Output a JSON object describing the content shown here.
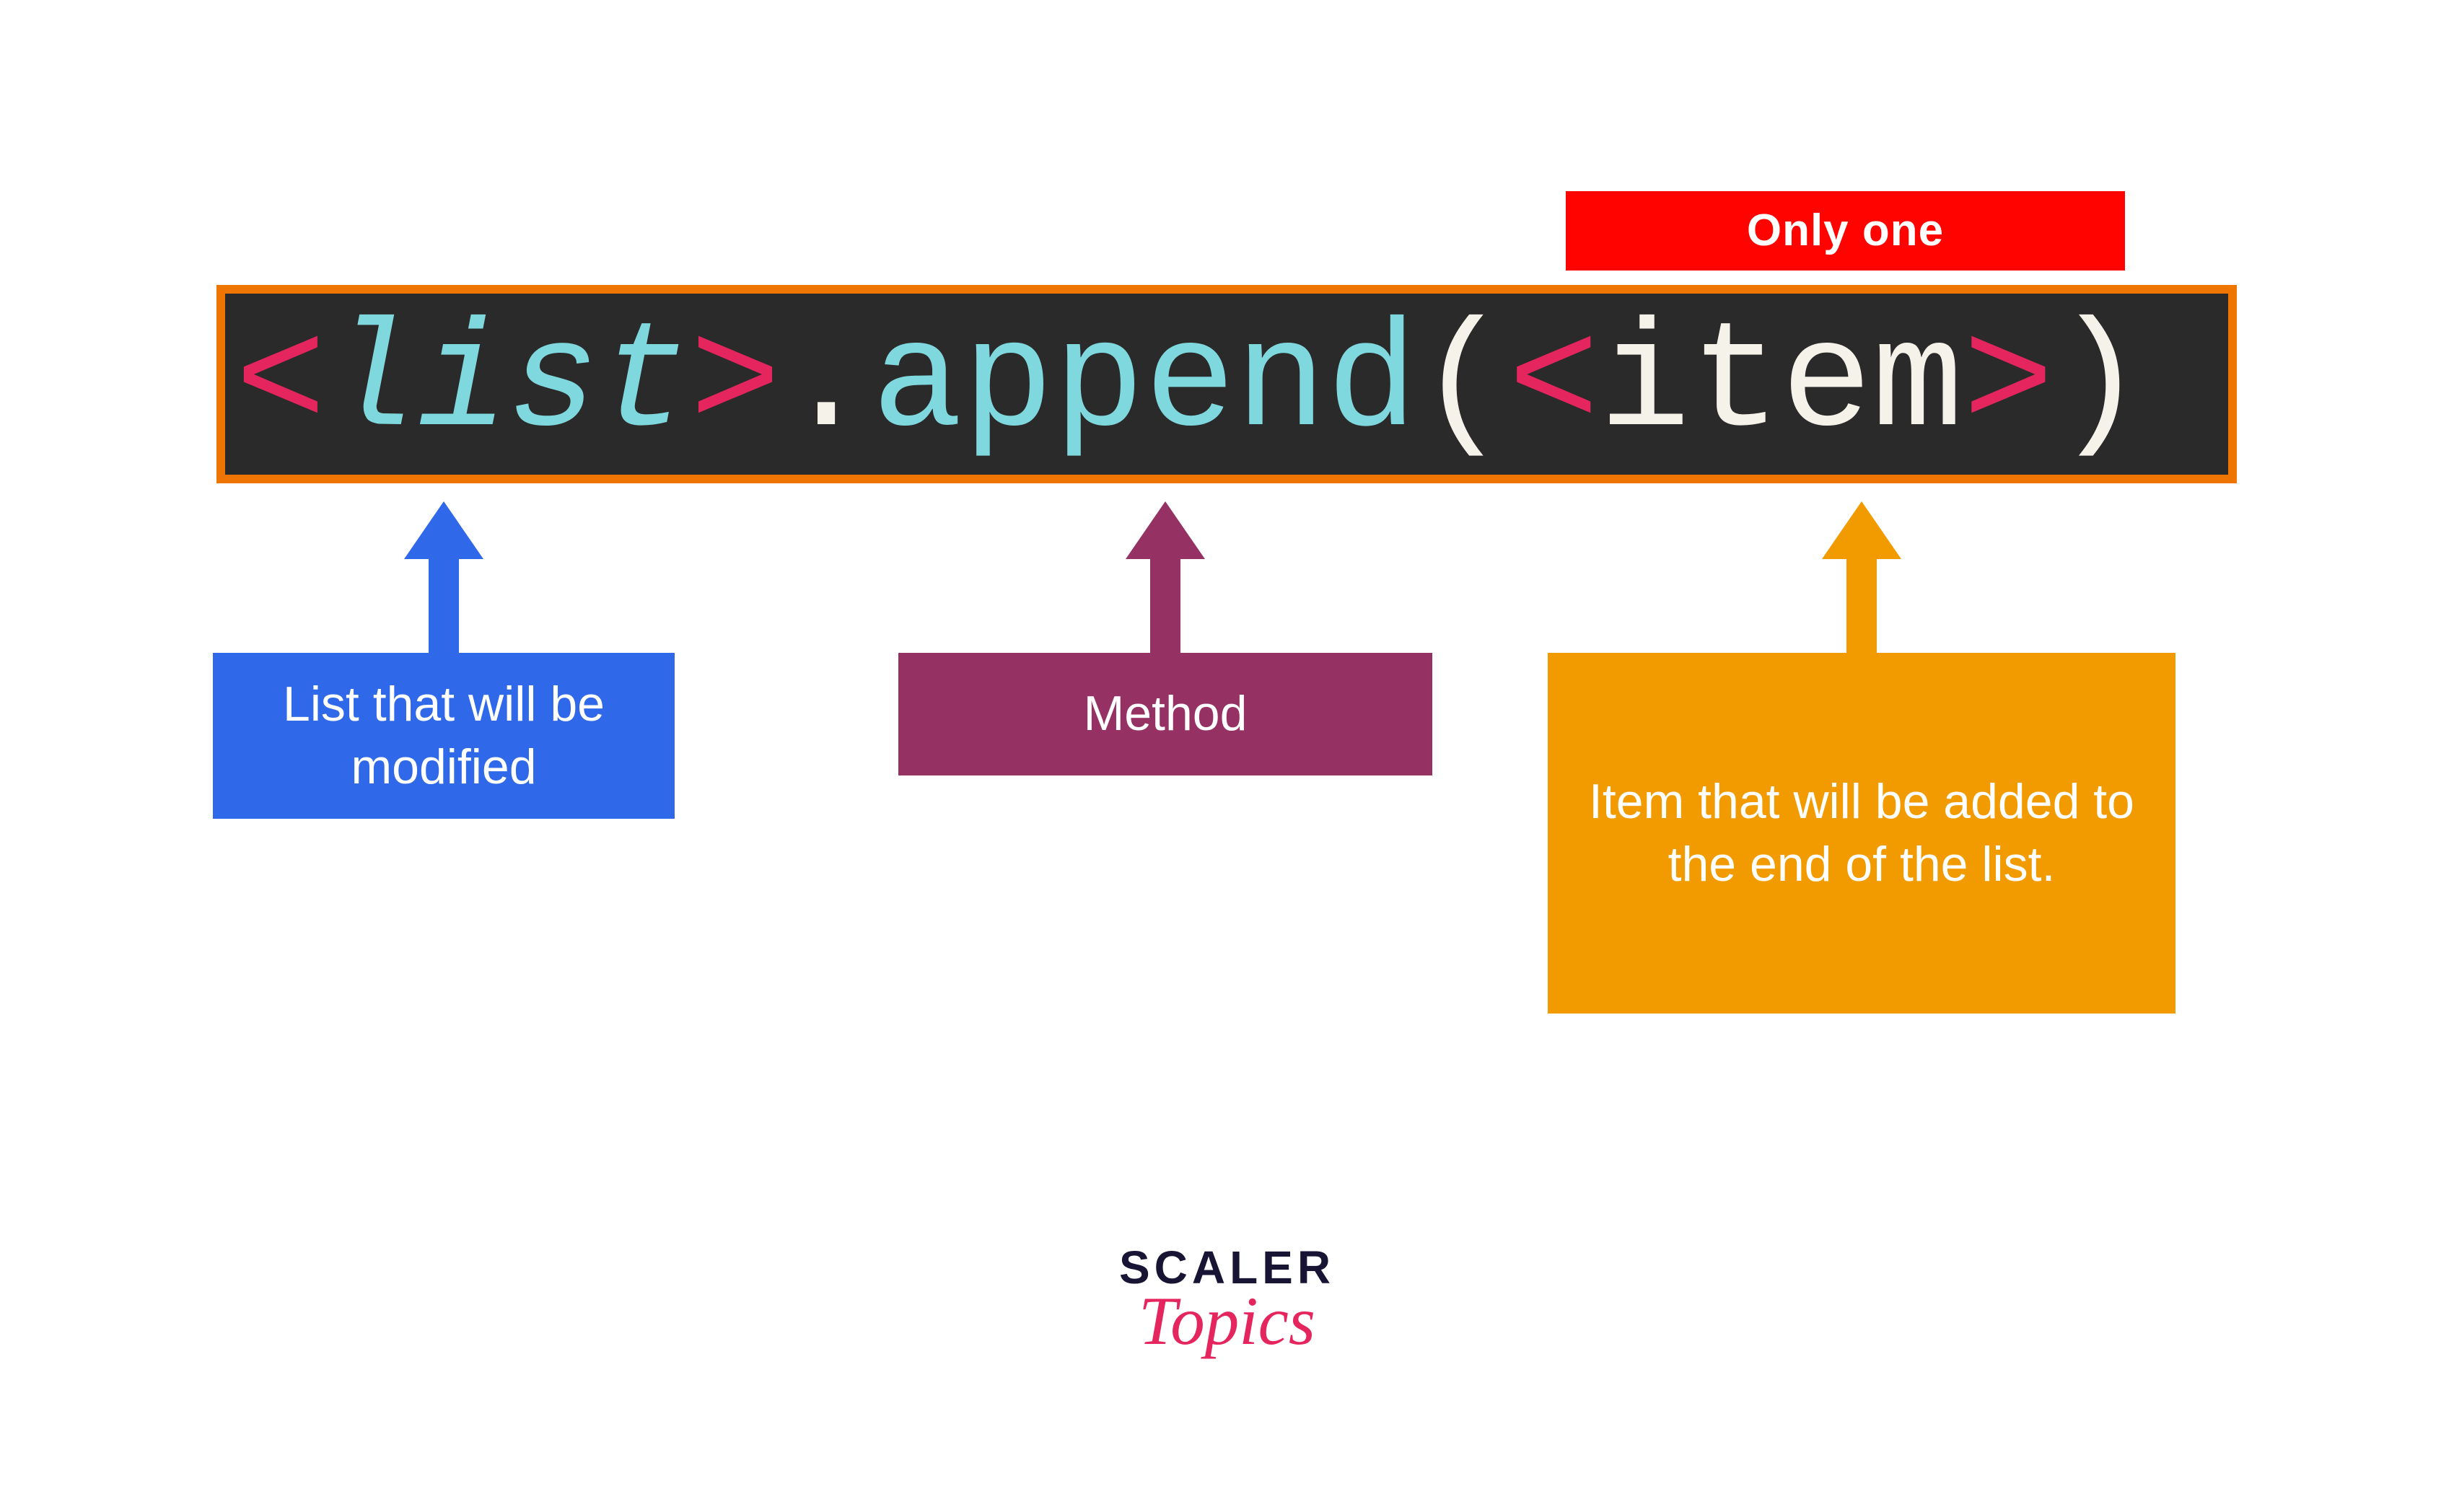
{
  "badge": {
    "only_one": "Only one"
  },
  "code": {
    "angle_open_1": "<",
    "list_word": "list",
    "angle_close_1": ">",
    "dot": ".",
    "append_word": "append",
    "paren_open": "(",
    "angle_open_2": "<",
    "item_word": "item",
    "angle_close_2": ">",
    "paren_close": ")"
  },
  "annotations": {
    "list": "List that will be modified",
    "method": "Method",
    "item": "Item that will be added to the end of the list."
  },
  "logo": {
    "line1": "SCALER",
    "line2": "Topics"
  }
}
